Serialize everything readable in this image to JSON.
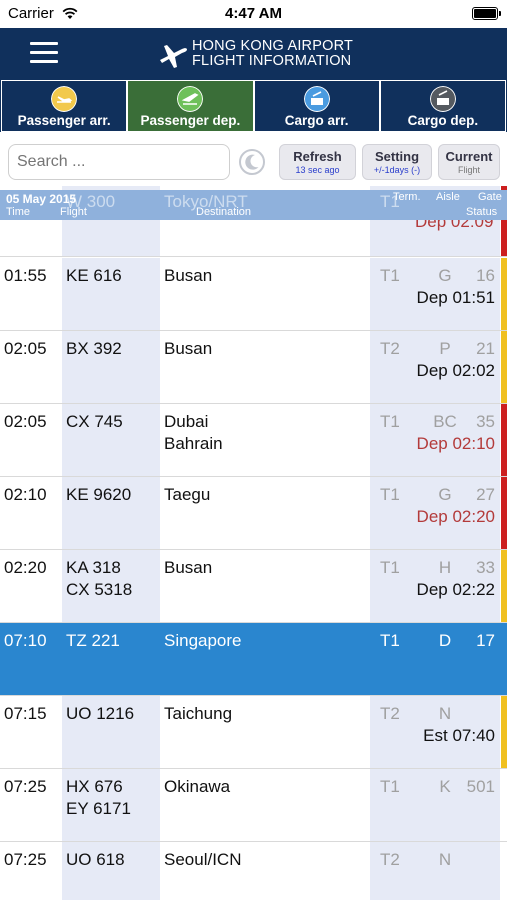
{
  "status_bar": {
    "carrier": "Carrier",
    "time": "4:47 AM"
  },
  "header": {
    "title_line1": "HONG KONG AIRPORT",
    "title_line2": "FLIGHT INFORMATION"
  },
  "tabs": [
    {
      "label": "Passenger arr.",
      "icon": "plane-arrival-icon",
      "active": false
    },
    {
      "label": "Passenger dep.",
      "icon": "plane-departure-icon",
      "active": true
    },
    {
      "label": "Cargo arr.",
      "icon": "cargo-arrival-icon",
      "active": false
    },
    {
      "label": "Cargo dep.",
      "icon": "cargo-departure-icon",
      "active": false
    }
  ],
  "toolbar": {
    "search_placeholder": "Search ...",
    "refresh_label": "Refresh",
    "refresh_sub": "13 sec ago",
    "setting_label": "Setting",
    "setting_sub": "+/-1days (-)",
    "current_label": "Current",
    "current_sub": "Flight"
  },
  "columns": {
    "date": "05 May 2015",
    "time": "Time",
    "flight": "Flight",
    "destination": "Destination",
    "terminal": "Term.",
    "aisle": "Aisle",
    "gate": "Gate",
    "status": "Status"
  },
  "colors": {
    "header_bg": "#10305c",
    "active_tab": "#3a6e38",
    "highlight_row": "#2a86cf",
    "bar_yellow": "#f0c020",
    "bar_red": "#cc1f1f"
  },
  "partial_row": {
    "flight": "W 300",
    "destination": "Tokyo/NRT",
    "terminal": "T1",
    "status": "Dep 02:09"
  },
  "flights": [
    {
      "time": "01:55",
      "flights": [
        "KE 616"
      ],
      "destinations": [
        "Busan"
      ],
      "terminal": "T1",
      "aisle": "G",
      "gate": "16",
      "status": "Dep 01:51",
      "status_color": "black",
      "bar": "yellow"
    },
    {
      "time": "02:05",
      "flights": [
        "BX 392"
      ],
      "destinations": [
        "Busan"
      ],
      "terminal": "T2",
      "aisle": "P",
      "gate": "21",
      "status": "Dep 02:02",
      "status_color": "black",
      "bar": "yellow"
    },
    {
      "time": "02:05",
      "flights": [
        "CX 745"
      ],
      "destinations": [
        "Dubai",
        "Bahrain"
      ],
      "terminal": "T1",
      "aisle": "BC",
      "gate": "35",
      "status": "Dep 02:10",
      "status_color": "red",
      "bar": "red"
    },
    {
      "time": "02:10",
      "flights": [
        "KE 9620"
      ],
      "destinations": [
        "Taegu"
      ],
      "terminal": "T1",
      "aisle": "G",
      "gate": "27",
      "status": "Dep 02:20",
      "status_color": "red",
      "bar": "red"
    },
    {
      "time": "02:20",
      "flights": [
        "KA 318",
        "CX 5318"
      ],
      "destinations": [
        "Busan"
      ],
      "terminal": "T1",
      "aisle": "H",
      "gate": "33",
      "status": "Dep 02:22",
      "status_color": "black",
      "bar": "yellow"
    },
    {
      "time": "07:10",
      "flights": [
        "TZ 221"
      ],
      "destinations": [
        "Singapore"
      ],
      "terminal": "T1",
      "aisle": "D",
      "gate": "17",
      "status": "",
      "status_color": "white",
      "bar": "none",
      "highlight": true
    },
    {
      "time": "07:15",
      "flights": [
        "UO 1216"
      ],
      "destinations": [
        "Taichung"
      ],
      "terminal": "T2",
      "aisle": "N",
      "gate": "",
      "status": "Est 07:40",
      "status_color": "black",
      "bar": "yellow"
    },
    {
      "time": "07:25",
      "flights": [
        "HX 676",
        "EY 6171"
      ],
      "destinations": [
        "Okinawa"
      ],
      "terminal": "T1",
      "aisle": "K",
      "gate": "501",
      "status": "",
      "status_color": "black",
      "bar": "none"
    },
    {
      "time": "07:25",
      "flights": [
        "UO 618"
      ],
      "destinations": [
        "Seoul/ICN"
      ],
      "terminal": "T2",
      "aisle": "N",
      "gate": "",
      "status": "",
      "status_color": "black",
      "bar": "none"
    }
  ]
}
